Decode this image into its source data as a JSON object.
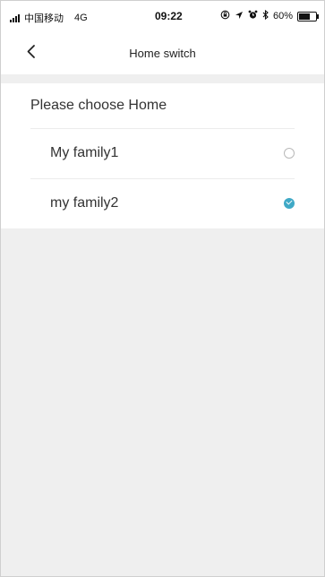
{
  "status_bar": {
    "carrier": "中国移动",
    "network": "4G",
    "time": "09:22",
    "battery_percent": "60%",
    "icons": [
      "signal-icon",
      "lock-rotation-icon",
      "location-icon",
      "alarm-icon",
      "bluetooth-icon",
      "battery-icon"
    ],
    "battery_level": 0.6
  },
  "nav": {
    "title": "Home switch",
    "back_icon": "back-chevron-icon"
  },
  "section": {
    "header": "Please choose Home"
  },
  "homes": [
    {
      "label": "My family1",
      "selected": false
    },
    {
      "label": "my family2",
      "selected": true
    }
  ],
  "colors": {
    "accent": "#3fa9c6",
    "background": "#efefef"
  }
}
